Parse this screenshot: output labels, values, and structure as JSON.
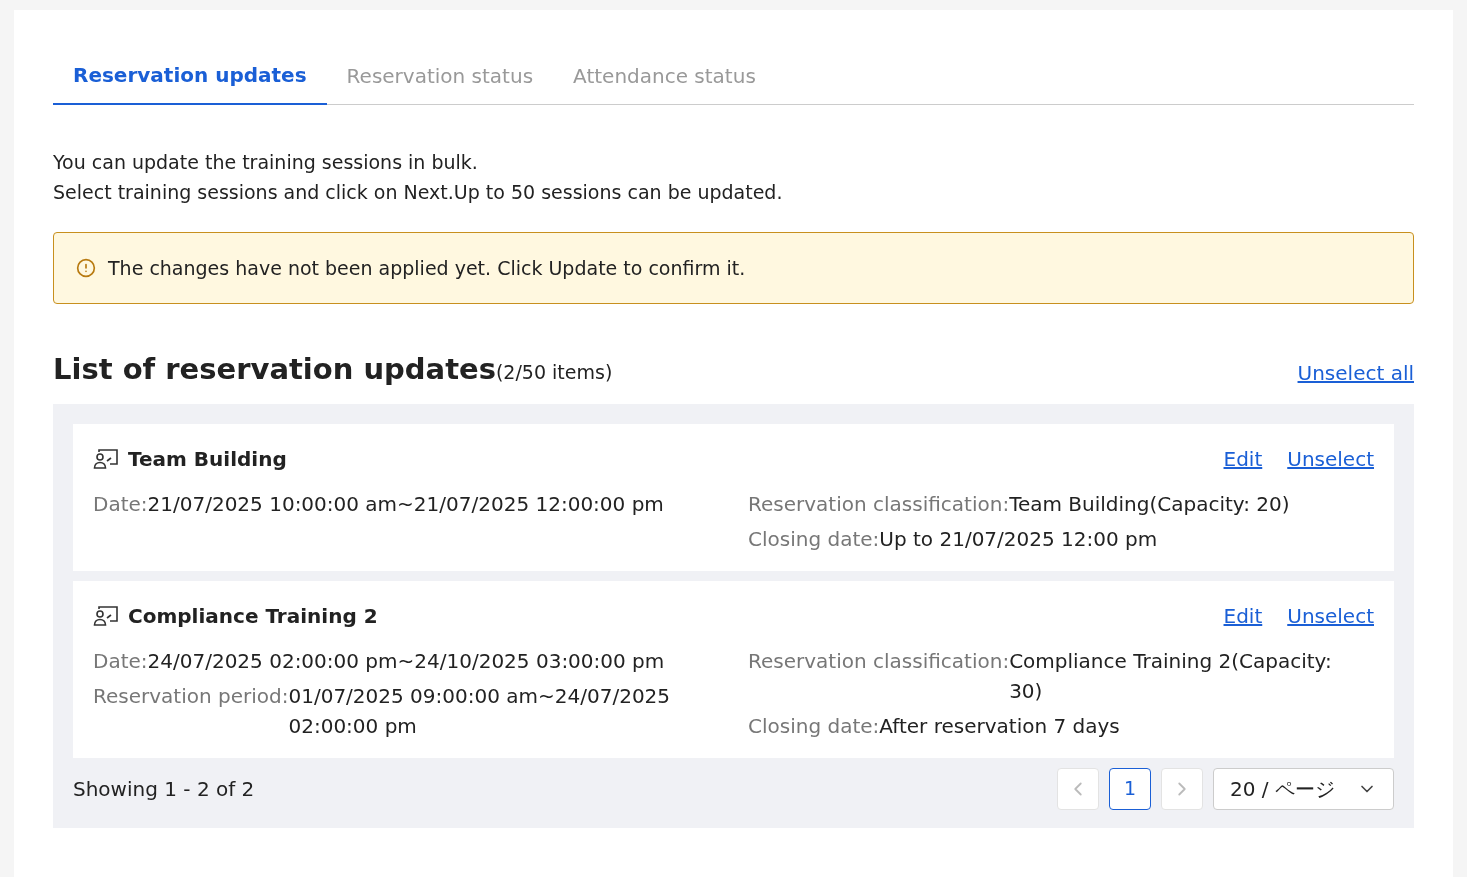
{
  "tabs": [
    {
      "label": "Reservation updates",
      "selected": true
    },
    {
      "label": "Reservation status",
      "selected": false
    },
    {
      "label": "Attendance status",
      "selected": false
    }
  ],
  "intro": [
    "You can update the training sessions in bulk.",
    "Select training sessions and click on Next.Up to 50 sessions can be updated."
  ],
  "alert": {
    "text": "The changes have not been applied yet. Click Update to confirm it."
  },
  "list": {
    "title": "List of reservation updates",
    "count": "(2/50 items)",
    "unselect_all": "Unselect all",
    "items": [
      {
        "name": "Team Building",
        "edit": "Edit",
        "unselect": "Unselect",
        "left": [
          {
            "label": "Date:",
            "value": "21/07/2025 10:00:00 am~21/07/2025 12:00:00 pm"
          }
        ],
        "right": [
          {
            "label": "Reservation classification:",
            "value": "Team Building(Capacity: 20)"
          },
          {
            "label": "Closing date:",
            "value": "Up to 21/07/2025 12:00 pm"
          }
        ]
      },
      {
        "name": "Compliance Training 2",
        "edit": "Edit",
        "unselect": "Unselect",
        "left": [
          {
            "label": "Date:",
            "value": "24/07/2025 02:00:00 pm~24/10/2025 03:00:00 pm"
          },
          {
            "label": "Reservation period:",
            "value": "01/07/2025 09:00:00 am~24/07/2025 02:00:00 pm"
          }
        ],
        "right": [
          {
            "label": "Reservation classification:",
            "value": "Compliance Training 2(Capacity: 30)"
          },
          {
            "label": "Closing date:",
            "value": "After reservation 7 days"
          }
        ]
      }
    ]
  },
  "pagination": {
    "summary": "Showing 1 - 2 of 2",
    "prev_disabled": true,
    "next_disabled": true,
    "pages": [
      {
        "label": "1",
        "selected": true
      }
    ],
    "page_size": "20 / ページ"
  }
}
